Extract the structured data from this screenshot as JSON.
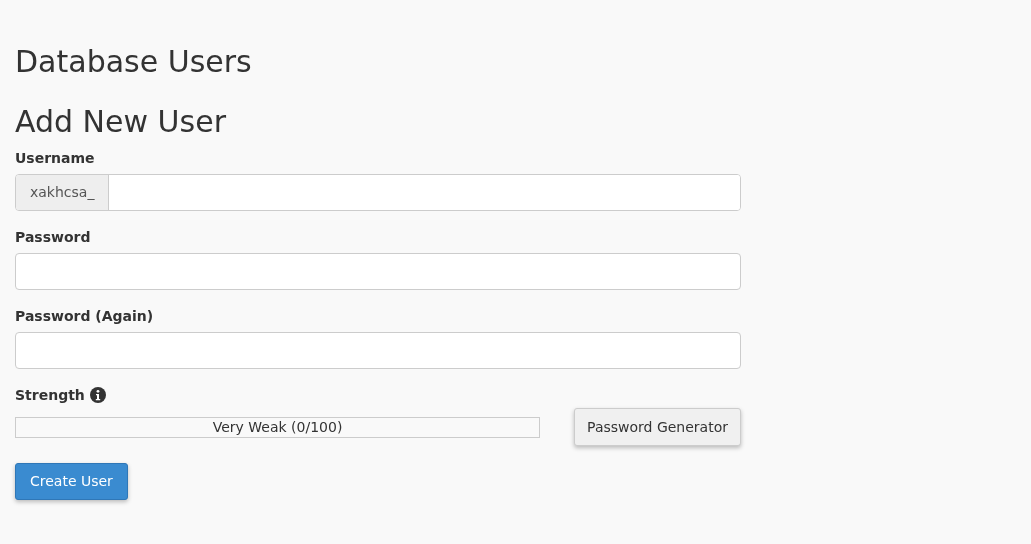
{
  "page_title": "Database Users",
  "section_title": "Add New User",
  "fields": [
    {
      "kind": "prefixed",
      "label": "Username",
      "prefix": "xakhcsa_"
    },
    {
      "kind": "password",
      "label": "Password"
    },
    {
      "kind": "password",
      "label": "Password (Again)"
    }
  ],
  "strength": {
    "label": "Strength",
    "level": 0,
    "reading": "Very Weak (0/100)"
  },
  "generator_button": "Password Generator",
  "submit_button": "Create User"
}
